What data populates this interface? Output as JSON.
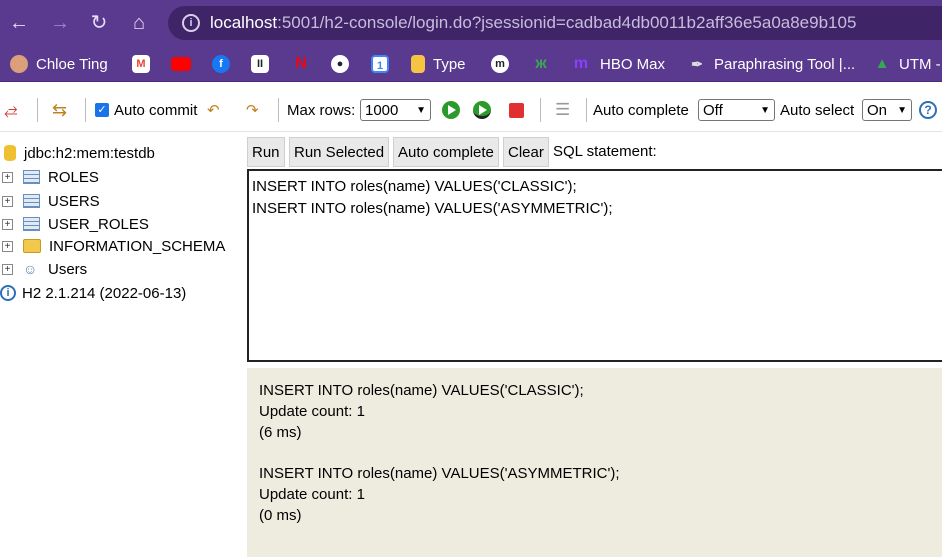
{
  "browser": {
    "url_host": "localhost",
    "url_rest": ":5001/h2-console/login.do?jsessionid=cadbad4db0011b2aff36e5a0a8e9b105",
    "bookmarks": [
      {
        "label": "Chloe Ting",
        "icon": "avatar-icon",
        "color": "#d9a07a"
      },
      {
        "label": "",
        "icon": "gmail-icon",
        "color": "#ea4335"
      },
      {
        "label": "",
        "icon": "youtube-icon",
        "color": "#ff0000"
      },
      {
        "label": "",
        "icon": "facebook-icon",
        "color": "#1877f2"
      },
      {
        "label": "",
        "icon": "pause-app-icon",
        "color": "#ffffff"
      },
      {
        "label": "",
        "icon": "netflix-icon",
        "color": "#e50914"
      },
      {
        "label": "",
        "icon": "github-icon",
        "color": "#ffffff"
      },
      {
        "label": "",
        "icon": "calendar-icon",
        "color": "#4285f4"
      },
      {
        "label": "Type",
        "icon": "note-icon",
        "color": "#f6c343"
      },
      {
        "label": "",
        "icon": "m-circle-icon",
        "color": "#ffffff"
      },
      {
        "label": "",
        "icon": "leaf-icon",
        "color": "#3aa655"
      },
      {
        "label": "HBO Max",
        "icon": "hbo-icon",
        "color": "#8a3ffc"
      },
      {
        "label": "Paraphrasing Tool |...",
        "icon": "feather-icon",
        "color": "#dddddd"
      },
      {
        "label": "UTM -",
        "icon": "drive-icon",
        "color": "#34a853"
      }
    ]
  },
  "toolbar": {
    "auto_commit_label": "Auto commit",
    "max_rows_label": "Max rows:",
    "max_rows_value": "1000",
    "auto_complete_label": "Auto complete",
    "auto_complete_value": "Off",
    "auto_select_label": "Auto select",
    "auto_select_value": "On",
    "help_label": "?"
  },
  "tree": {
    "connection": "jdbc:h2:mem:testdb",
    "items": [
      {
        "label": "ROLES",
        "kind": "table"
      },
      {
        "label": "USERS",
        "kind": "table"
      },
      {
        "label": "USER_ROLES",
        "kind": "table"
      },
      {
        "label": "INFORMATION_SCHEMA",
        "kind": "folder"
      },
      {
        "label": "Users",
        "kind": "users"
      }
    ],
    "version": "H2 2.1.214 (2022-06-13)"
  },
  "query_buttons": {
    "run": "Run",
    "run_selected": "Run Selected",
    "auto_complete": "Auto complete",
    "clear": "Clear",
    "sql_label": "SQL statement:"
  },
  "editor": {
    "lines": [
      "INSERT INTO roles(name) VALUES('CLASSIC');",
      "INSERT INTO roles(name) VALUES('ASYMMETRIC');"
    ]
  },
  "results": [
    {
      "statement": "INSERT INTO roles(name) VALUES('CLASSIC');",
      "count": "Update count: 1",
      "time": "(6 ms)"
    },
    {
      "statement": "INSERT INTO roles(name) VALUES('ASYMMETRIC');",
      "count": "Update count: 1",
      "time": "(0 ms)"
    }
  ]
}
